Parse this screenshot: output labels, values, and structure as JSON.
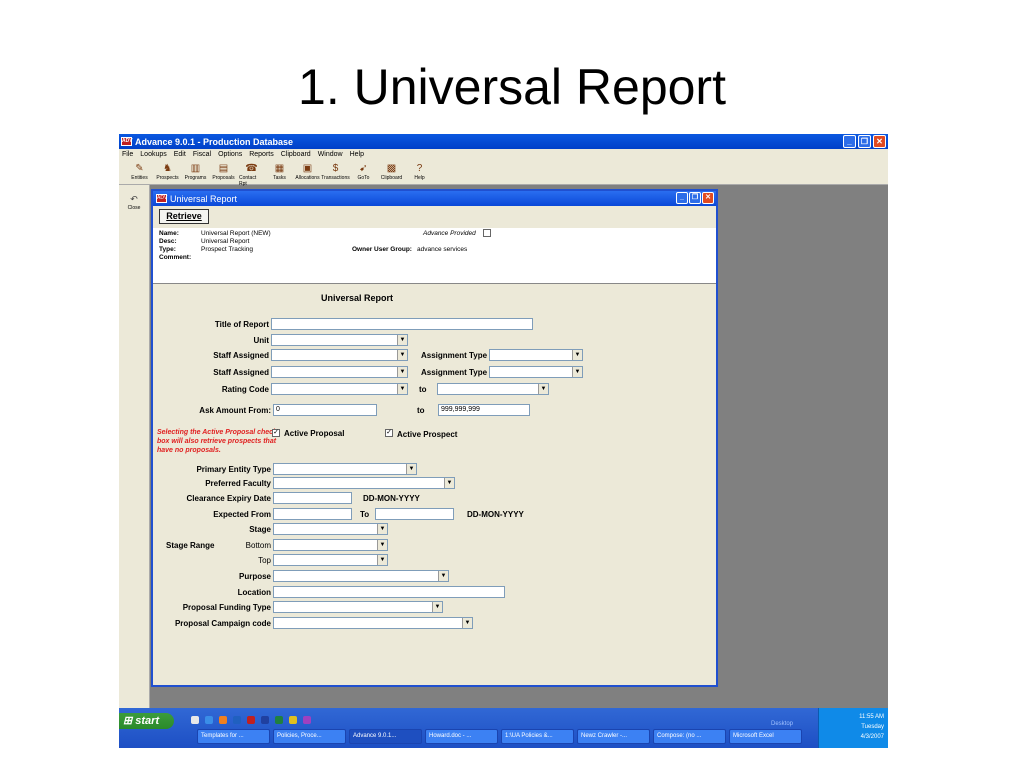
{
  "slide": {
    "title": "1. Universal Report"
  },
  "app": {
    "icon_text": "ADV",
    "title": "Advance 9.0.1  - Production Database",
    "menu": [
      "File",
      "Lookups",
      "Edit",
      "Fiscal",
      "Options",
      "Reports",
      "Clipboard",
      "Window",
      "Help"
    ],
    "toolbar": [
      {
        "label": "Entities",
        "icon": "entities-icon",
        "glyph": "✎"
      },
      {
        "label": "Prospects",
        "icon": "prospects-icon",
        "glyph": "♞"
      },
      {
        "label": "Programs",
        "icon": "programs-icon",
        "glyph": "▥"
      },
      {
        "label": "Proposals",
        "icon": "proposals-icon",
        "glyph": "▤"
      },
      {
        "label": "Contact Rpt",
        "icon": "contact-report-icon",
        "glyph": "☎"
      },
      {
        "label": "Tasks",
        "icon": "tasks-icon",
        "glyph": "▦"
      },
      {
        "label": "Allocations",
        "icon": "allocations-icon",
        "glyph": "▣"
      },
      {
        "label": "Transactions",
        "icon": "transactions-icon",
        "glyph": "$"
      },
      {
        "label": "GoTo",
        "icon": "goto-icon",
        "glyph": "➹"
      },
      {
        "label": "Clipboard",
        "icon": "clipboard-icon",
        "glyph": "▩"
      },
      {
        "label": "Help",
        "icon": "help-icon",
        "glyph": "?"
      }
    ],
    "left_tool": {
      "label": "Close",
      "icon": "undo-close-icon"
    }
  },
  "child": {
    "title": "Universal Report",
    "retrieve": "Retrieve",
    "info": {
      "name_lbl": "Name:",
      "name_val": "Universal Report (NEW)",
      "desc_lbl": "Desc:",
      "desc_val": "Universal Report",
      "type_lbl": "Type:",
      "type_val": "Prospect Tracking",
      "comment_lbl": "Comment:",
      "adv_provided": "Advance Provided",
      "owner_lbl": "Owner User Group:",
      "owner_val": "advance services"
    }
  },
  "form": {
    "heading": "Universal Report",
    "title_of_report": "Title of Report",
    "unit": "Unit",
    "staff_assigned": "Staff Assigned",
    "assignment_type": "Assignment Type",
    "rating_code": "Rating Code",
    "to": "to",
    "ask_amount_from": "Ask Amount From:",
    "ask_from_val": "0",
    "ask_to_val": "999,999,999",
    "warning": "Selecting the Active Proposal check box will also retrieve prospects that have no proposals.",
    "active_proposal": "Active Proposal",
    "active_prospect": "Active Prospect",
    "primary_entity_type": "Primary Entity Type",
    "preferred_faculty": "Preferred Faculty",
    "clearance_expiry_date": "Clearance Expiry Date",
    "date_fmt": "DD-MON-YYYY",
    "expected_from": "Expected From",
    "to_cap": "To",
    "stage": "Stage",
    "stage_range": "Stage Range",
    "bottom": "Bottom",
    "top": "Top",
    "purpose": "Purpose",
    "location": "Location",
    "proposal_funding_type": "Proposal Funding Type",
    "proposal_campaign_code": "Proposal Campaign code"
  },
  "taskbar": {
    "start": "start",
    "desktop": "Desktop",
    "tasks": [
      "Templates for ...",
      "Policies, Proce...",
      "Advance 9.0.1...",
      "Howard.doc - ...",
      "1:\\UA Policies &...",
      "Newz Crawler -...",
      "Compose: (no ...",
      "Microsoft Excel"
    ],
    "clock": "11:55 AM",
    "day": "Tuesday",
    "date": "4/3/2007"
  }
}
